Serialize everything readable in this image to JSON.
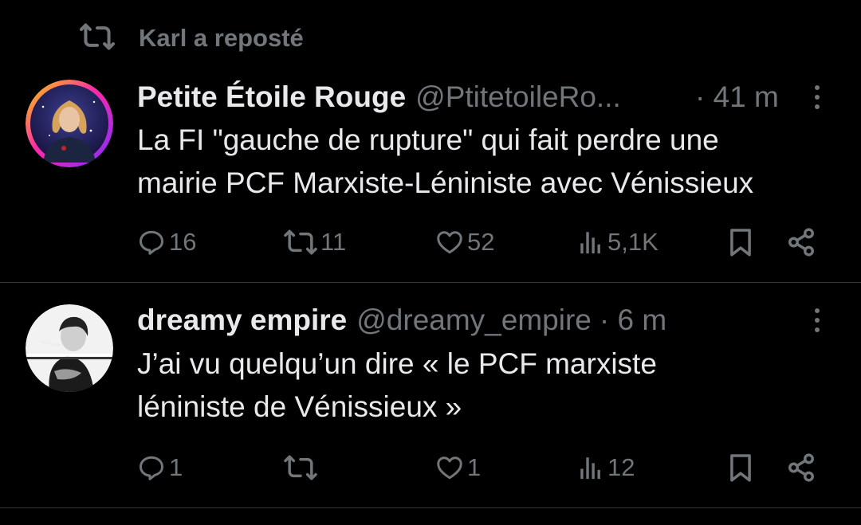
{
  "repost": {
    "icon": "repost-icon",
    "label": "Karl a reposté"
  },
  "tweets": [
    {
      "display_name": "Petite Étoile Rouge",
      "handle": "@PtitetoileRo...",
      "time": "· 41 m",
      "text": "La FI \"gauche de rupture\" qui fait perdre une\nmairie PCF Marxiste-Léniniste avec Vénissieux",
      "stats": {
        "replies": "16",
        "reposts": "11",
        "likes": "52",
        "views": "5,1K"
      }
    },
    {
      "display_name": "dreamy empire",
      "handle": "@dreamy_empire",
      "time": "· 6 m",
      "text": "J’ai vu quelqu’un dire « le PCF marxiste\nléniniste de Vénissieux »",
      "stats": {
        "replies": "1",
        "reposts": "",
        "likes": "1",
        "views": "12"
      }
    }
  ],
  "colors": {
    "background": "#000000",
    "text": "#e7e9ea",
    "muted": "#71767b",
    "divider": "#2f3336"
  },
  "icons": [
    "reply-icon",
    "repost-icon",
    "like-icon",
    "views-icon",
    "bookmark-icon",
    "share-icon",
    "more-icon"
  ]
}
